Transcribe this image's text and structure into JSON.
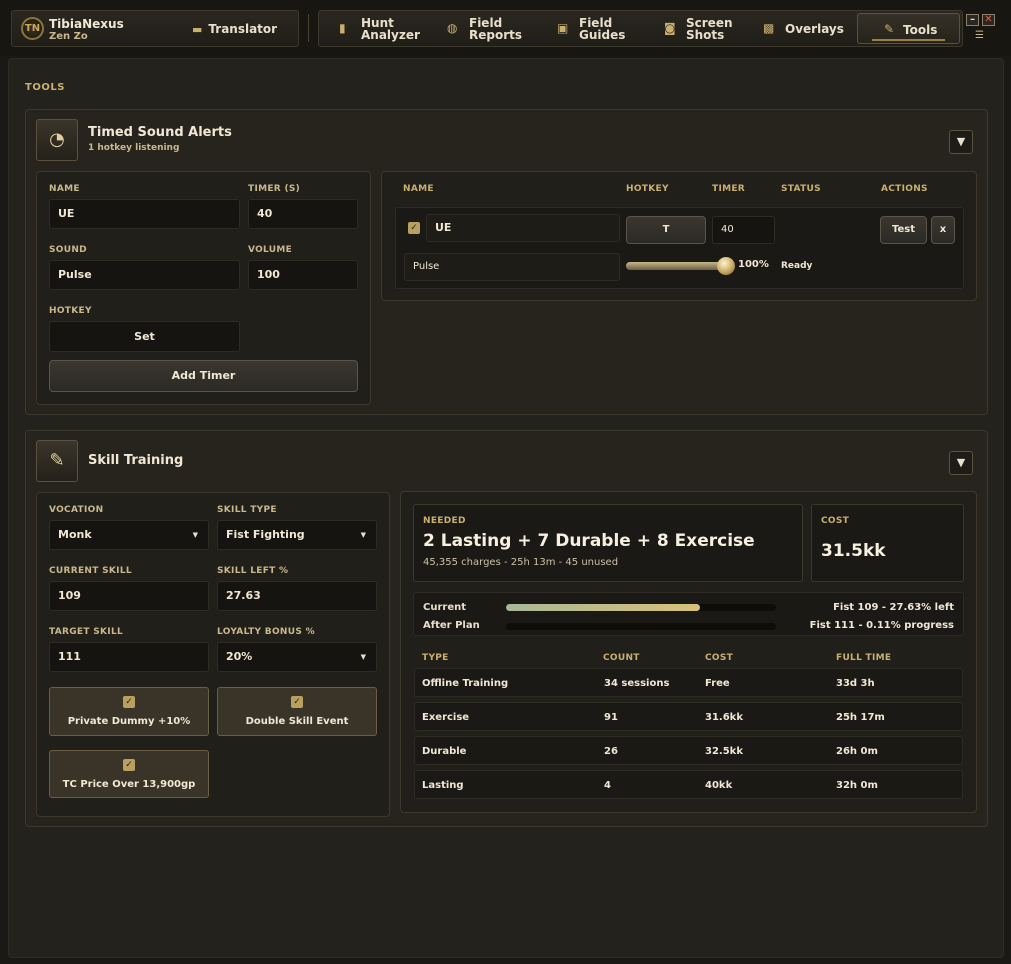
{
  "app": {
    "name": "TibiaNexus",
    "user": "Zen Zo",
    "translator_label": "Translator"
  },
  "nav": [
    {
      "label": "Hunt\nAnalyzer",
      "icon": "chart-bars-icon"
    },
    {
      "label": "Field\nReports",
      "icon": "globe-icon"
    },
    {
      "label": "Field\nGuides",
      "icon": "book-icon"
    },
    {
      "label": "Screen\nShots",
      "icon": "camera-icon"
    },
    {
      "label": "Overlays",
      "icon": "overlay-icon"
    },
    {
      "label": "Tools",
      "icon": "wrench-icon",
      "active": true
    }
  ],
  "window": {
    "minimize": "–",
    "close": "✕",
    "settings": "☰"
  },
  "page_title": "TOOLS",
  "sound_alerts": {
    "title": "Timed Sound Alerts",
    "subtitle": "1 hotkey listening",
    "form": {
      "name_label": "NAME",
      "name_value": "UE",
      "timer_label": "TIMER (S)",
      "timer_value": "40",
      "sound_label": "SOUND",
      "sound_value": "Pulse",
      "volume_label": "VOLUME",
      "volume_value": "100",
      "hotkey_label": "HOTKEY",
      "hotkey_button": "Set",
      "add_button": "Add Timer"
    },
    "table": {
      "headers": {
        "name": "NAME",
        "hotkey": "HOTKEY",
        "timer": "TIMER",
        "status": "STATUS",
        "actions": "ACTIONS"
      },
      "row": {
        "enabled": true,
        "name": "UE",
        "hotkey": "T",
        "timer": "40",
        "sound": "Pulse",
        "volume_text": "100%",
        "volume": 1.0,
        "status": "Ready",
        "test_button": "Test",
        "delete_button": "x"
      }
    }
  },
  "skill_training": {
    "title": "Skill Training",
    "form": {
      "vocation_label": "VOCATION",
      "vocation_value": "Monk",
      "skill_type_label": "SKILL TYPE",
      "skill_type_value": "Fist Fighting",
      "current_skill_label": "CURRENT SKILL",
      "current_skill_value": "109",
      "skill_left_label": "SKILL LEFT %",
      "skill_left_value": "27.63",
      "target_skill_label": "TARGET SKILL",
      "target_skill_value": "111",
      "loyalty_label": "LOYALTY BONUS %",
      "loyalty_value": "20%",
      "toggles": [
        "Private Dummy +10%",
        "Double Skill Event",
        "TC Price Over 13,900gp"
      ]
    },
    "summary": {
      "needed_label": "NEEDED",
      "needed_value": "2 Lasting + 7 Durable + 8 Exercise",
      "needed_detail": "45,355 charges - 25h 13m - 45 unused",
      "cost_label": "COST",
      "cost_value": "31.5kk"
    },
    "progress": {
      "current_label": "Current",
      "current_fraction": 0.72,
      "current_text": "Fist 109 - 27.63% left",
      "after_label": "After Plan",
      "after_fraction": 0.0,
      "after_text": "Fist 111 - 0.11% progress"
    },
    "plan_table": {
      "headers": {
        "type": "TYPE",
        "count": "COUNT",
        "cost": "COST",
        "time": "FULL TIME"
      },
      "rows": [
        {
          "type": "Offline Training",
          "count": "34 sessions",
          "cost": "Free",
          "time": "33d 3h"
        },
        {
          "type": "Exercise",
          "count": "91",
          "cost": "31.6kk",
          "time": "25h 17m"
        },
        {
          "type": "Durable",
          "count": "26",
          "cost": "32.5kk",
          "time": "26h 0m"
        },
        {
          "type": "Lasting",
          "count": "4",
          "cost": "40kk",
          "time": "32h 0m"
        }
      ]
    }
  },
  "colors": {
    "accent": "#c9b070",
    "panel": "#27241e",
    "background": "#1b1915",
    "progress_start": "#a8b898",
    "progress_end": "#d8c078"
  }
}
